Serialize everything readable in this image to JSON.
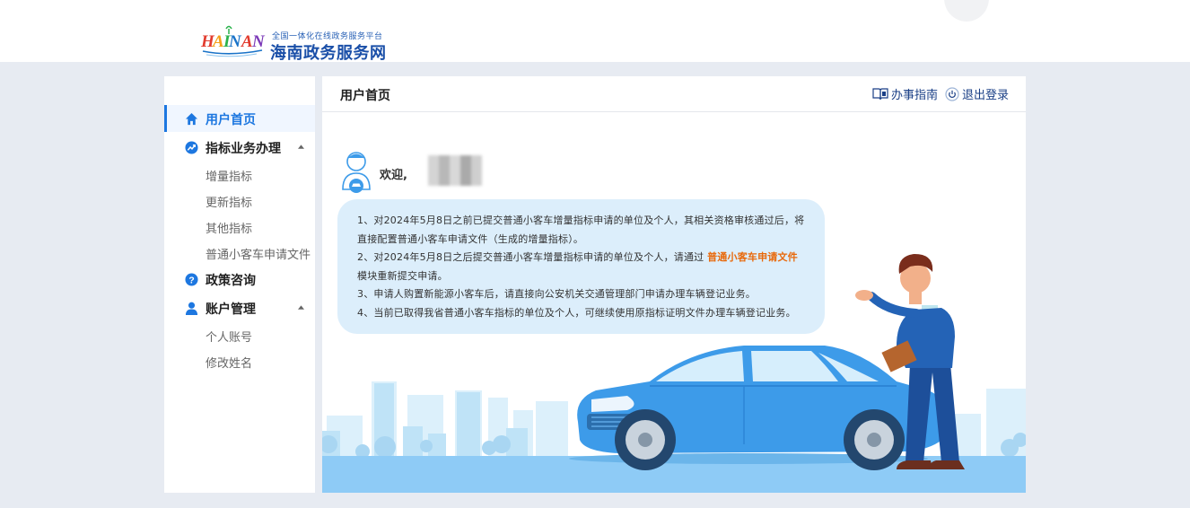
{
  "header": {
    "logo_text": "HAINAN",
    "subtitle": "全国一体化在线政务服务平台",
    "title": "海南政务服务网"
  },
  "sidebar": {
    "items": [
      {
        "label": "用户首页",
        "active": true,
        "icon": "home-icon"
      },
      {
        "label": "指标业务办理",
        "icon": "trend-icon",
        "expanded": true,
        "children": [
          "增量指标",
          "更新指标",
          "其他指标",
          "普通小客车申请文件"
        ]
      },
      {
        "label": "政策咨询",
        "icon": "question-icon"
      },
      {
        "label": "账户管理",
        "icon": "user-icon",
        "expanded": true,
        "children": [
          "个人账号",
          "修改姓名"
        ]
      }
    ]
  },
  "main": {
    "title": "用户首页",
    "guide_label": "办事指南",
    "logout_label": "退出登录",
    "welcome": "欢迎,",
    "notices": {
      "n1": "1、对2024年5月8日之前已提交普通小客车增量指标申请的单位及个人，其相关资格审核通过后，将直接配置普通小客车申请文件（生成的增量指标）。",
      "n2_before": "2、对2024年5月8日之后提交普通小客车增量指标申请的单位及个人，请通过",
      "n2_link": "普通小客车申请文件",
      "n2_after": "模块重新提交申请。",
      "n3": "3、申请人购置新能源小客车后，请直接向公安机关交通管理部门申请办理车辆登记业务。",
      "n4": "4、当前已取得我省普通小客车指标的单位及个人，可继续使用原指标证明文件办理车辆登记业务。"
    }
  },
  "colors": {
    "accent": "#1d77e0",
    "page_bg": "#e7ebf2",
    "bubble_bg": "#dceefb",
    "highlight": "#e8690b",
    "car": "#3d9be9"
  }
}
